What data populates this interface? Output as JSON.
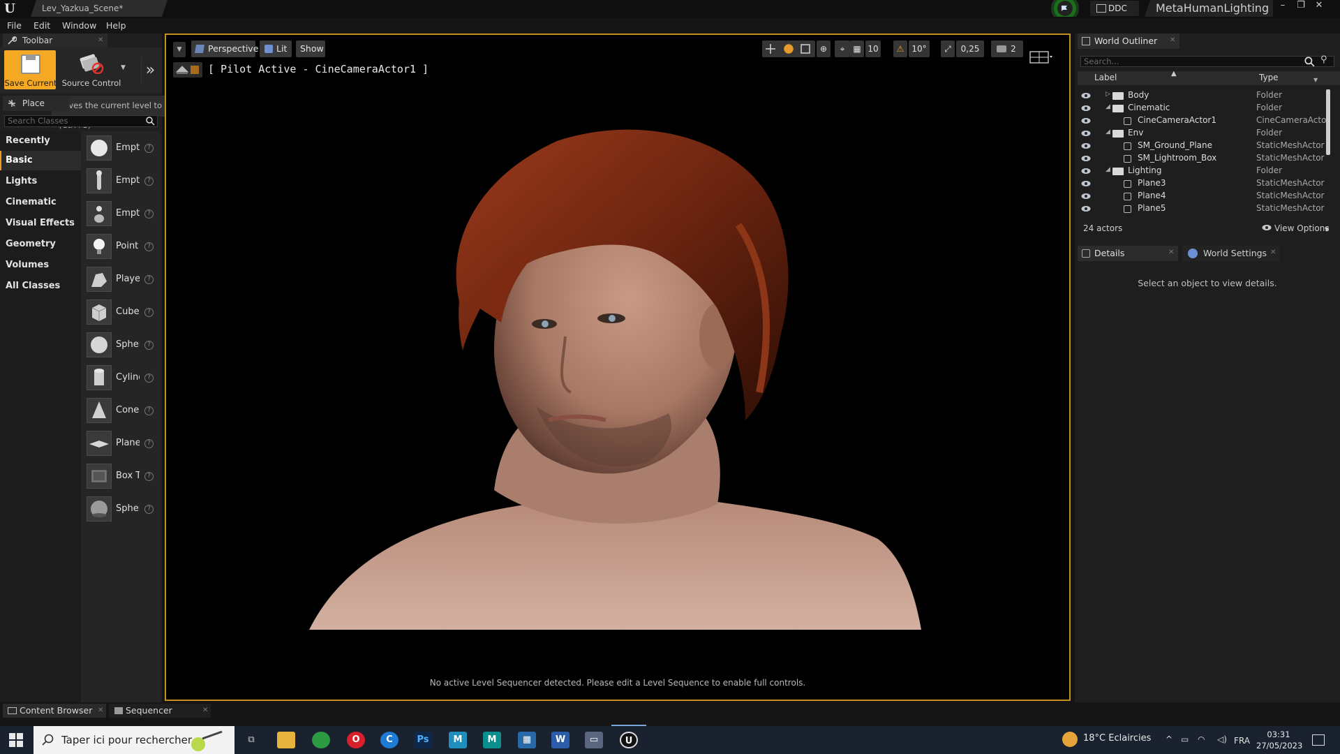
{
  "window": {
    "doc_tab": "Lev_Yazkua_Scene*",
    "ddc_label": "DDC",
    "project_name": "MetaHumanLighting",
    "controls": [
      "–",
      "❐",
      "✕"
    ]
  },
  "menu": [
    "File",
    "Edit",
    "Window",
    "Help"
  ],
  "toolbar": {
    "tab_label": "Toolbar",
    "save_label": "Save Current",
    "source_control_label": "Source Control",
    "tooltip": "Saves the current level to disk (Ctrl+S)"
  },
  "place_actors": {
    "tab_label": "Place Actors",
    "search_placeholder": "Search Classes",
    "categories": [
      "Recently Placed",
      "Basic",
      "Lights",
      "Cinematic",
      "Visual Effects",
      "Geometry",
      "Volumes",
      "All Classes"
    ],
    "active_category": "Basic",
    "items": [
      "Empty Actor",
      "Empty Character",
      "Empty Pawn",
      "Point Light",
      "Player Start",
      "Cube",
      "Sphere",
      "Cylinder",
      "Cone",
      "Plane",
      "Box Trigger",
      "Sphere Trigger"
    ]
  },
  "viewport": {
    "perspective_label": "Perspective",
    "lit_label": "Lit",
    "show_label": "Show",
    "pilot_label": "[ Pilot Active - CineCameraActor1 ]",
    "grid_snap": "10",
    "rot_snap": "10°",
    "scale_snap": "0,25",
    "cam_speed": "2",
    "status": "No active Level Sequencer detected. Please edit a Level Sequence to enable full controls.",
    "border_color": "#c69021"
  },
  "outliner": {
    "tab_label": "World Outliner",
    "search_placeholder": "Search...",
    "col_label": "Label",
    "col_type": "Type",
    "rows": [
      {
        "label": "Body",
        "type": "Folder",
        "kind": "folder",
        "indent": 0,
        "collapsed": true
      },
      {
        "label": "Cinematic",
        "type": "Folder",
        "kind": "folder",
        "indent": 0,
        "collapsed": false
      },
      {
        "label": "CineCameraActor1",
        "type": "CineCameraActor",
        "kind": "actor",
        "indent": 1
      },
      {
        "label": "Env",
        "type": "Folder",
        "kind": "folder",
        "indent": 0,
        "collapsed": false
      },
      {
        "label": "SM_Ground_Plane",
        "type": "StaticMeshActor",
        "kind": "actor",
        "indent": 1
      },
      {
        "label": "SM_Lightroom_Box",
        "type": "StaticMeshActor",
        "kind": "actor",
        "indent": 1
      },
      {
        "label": "Lighting",
        "type": "Folder",
        "kind": "folder",
        "indent": 0,
        "collapsed": false
      },
      {
        "label": "Plane3",
        "type": "StaticMeshActor",
        "kind": "actor",
        "indent": 1
      },
      {
        "label": "Plane4",
        "type": "StaticMeshActor",
        "kind": "actor",
        "indent": 1
      },
      {
        "label": "Plane5",
        "type": "StaticMeshActor",
        "kind": "actor",
        "indent": 1
      }
    ],
    "actor_count": "24 actors",
    "view_options": "View Options"
  },
  "details": {
    "tab_label": "Details",
    "world_settings_label": "World Settings",
    "empty_message": "Select an object to view details."
  },
  "bottom_tabs": [
    "Content Browser",
    "Sequencer"
  ],
  "taskbar": {
    "search_placeholder": "Taper ici pour rechercher",
    "weather": "18°C  Eclaircies",
    "lang": "FRA",
    "time": "03:31",
    "date": "27/05/2023"
  },
  "colors": {
    "accent": "#f4a823",
    "viewport_border": "#c69021"
  }
}
